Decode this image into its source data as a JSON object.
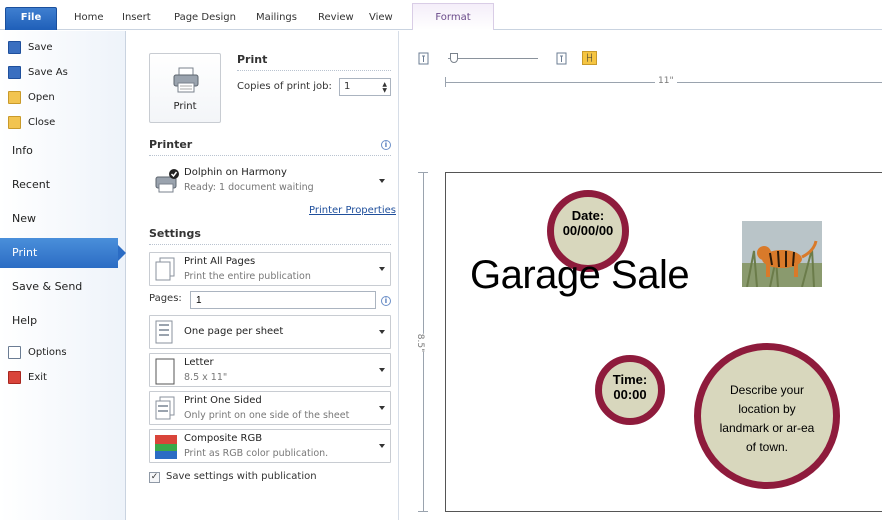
{
  "ribbon": {
    "tabs": [
      "File",
      "Home",
      "Insert",
      "Page Design",
      "Mailings",
      "Review",
      "View",
      "Format"
    ]
  },
  "nav": {
    "top_items": [
      "Save",
      "Save As",
      "Open",
      "Close"
    ],
    "main_items": [
      "Info",
      "Recent",
      "New",
      "Print",
      "Save & Send",
      "Help"
    ],
    "bottom_items": [
      "Options",
      "Exit"
    ],
    "active": "Print"
  },
  "print": {
    "section_title": "Print",
    "button_label": "Print",
    "copies_label": "Copies of print job:",
    "copies_value": "1"
  },
  "printer": {
    "section_title": "Printer",
    "name": "Dolphin on Harmony",
    "status": "Ready: 1 document waiting",
    "properties_link": "Printer Properties"
  },
  "settings": {
    "section_title": "Settings",
    "pages_label": "Pages:",
    "pages_value": "1",
    "dropdowns": [
      {
        "title": "Print All Pages",
        "subtitle": "Print the entire publication"
      },
      {
        "title": "One page per sheet",
        "subtitle": ""
      },
      {
        "title": "Letter",
        "subtitle": "8.5 x 11\""
      },
      {
        "title": "Print One Sided",
        "subtitle": "Only print on one side of the sheet"
      },
      {
        "title": "Composite RGB",
        "subtitle": "Print as RGB color publication."
      }
    ],
    "save_settings_label": "Save settings with publication",
    "save_settings_checked": true
  },
  "preview": {
    "ruler_width_label": "11\"",
    "ruler_height_label": "8.5\"",
    "date_label": "Date:",
    "date_value": "00/00/00",
    "headline": "Garage Sale",
    "time_label": "Time:",
    "time_value": "00:00",
    "location_text": "Describe your location by landmark or ar-ea of town."
  },
  "colors": {
    "accent": "#2b6cc4",
    "circle_border": "#8e1b3c",
    "circle_fill": "#d8d7bd"
  }
}
